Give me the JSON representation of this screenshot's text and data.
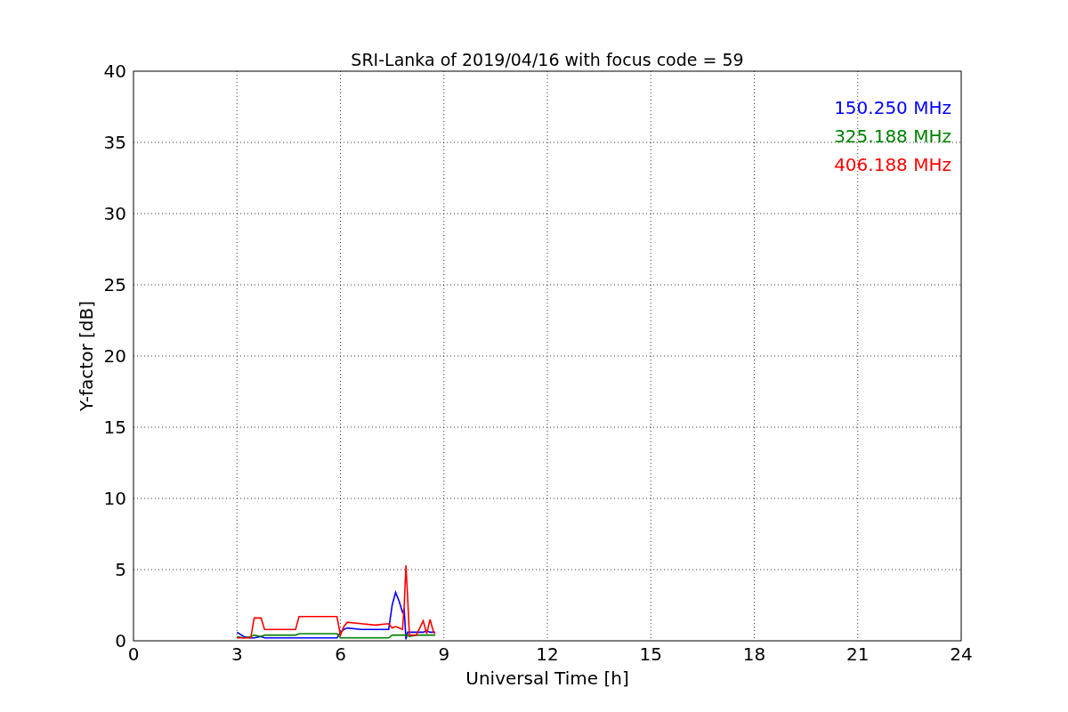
{
  "chart_data": {
    "type": "line",
    "grid": true,
    "title": "SRI-Lanka of 2019/04/16 with focus code = 59",
    "xlabel": "Universal Time [h]",
    "ylabel": "Y-factor [dB]",
    "xlim": [
      0,
      24
    ],
    "ylim": [
      0,
      40
    ],
    "xticks": [
      0,
      3,
      6,
      9,
      12,
      15,
      18,
      21,
      24
    ],
    "yticks": [
      0,
      5,
      10,
      15,
      20,
      25,
      30,
      35,
      40
    ],
    "x": [
      3.0,
      3.2,
      3.4,
      3.5,
      3.7,
      3.8,
      4.2,
      4.7,
      4.8,
      5.4,
      5.9,
      6.0,
      6.1,
      6.2,
      6.6,
      7.0,
      7.4,
      7.5,
      7.6,
      7.7,
      7.8,
      7.85,
      7.9,
      7.95,
      8.0,
      8.2,
      8.4,
      8.5,
      8.6,
      8.7,
      8.75
    ],
    "series": [
      {
        "name": "150.250 MHz",
        "color": "#0000ff",
        "values": [
          0.6,
          0.3,
          0.2,
          0.2,
          0.3,
          0.2,
          0.2,
          0.2,
          0.2,
          0.2,
          0.2,
          0.6,
          0.8,
          0.9,
          0.8,
          0.8,
          0.8,
          2.5,
          3.4,
          2.8,
          2.0,
          2.2,
          0.1,
          0.6,
          0.6,
          0.6,
          0.6,
          0.7,
          0.6,
          0.6,
          0.6
        ]
      },
      {
        "name": "325.188 MHz",
        "color": "#008000",
        "values": [
          0.3,
          0.2,
          0.3,
          0.4,
          0.3,
          0.4,
          0.4,
          0.4,
          0.5,
          0.5,
          0.5,
          0.2,
          0.2,
          0.2,
          0.2,
          0.2,
          0.2,
          0.4,
          0.4,
          0.4,
          0.4,
          0.4,
          0.4,
          0.4,
          0.3,
          0.4,
          0.4,
          0.4,
          0.4,
          0.4,
          0.4
        ]
      },
      {
        "name": "406.188 MHz",
        "color": "#ff0000",
        "values": [
          0.2,
          0.2,
          0.2,
          1.6,
          1.6,
          0.8,
          0.8,
          0.8,
          1.7,
          1.7,
          1.7,
          0.4,
          1.0,
          1.3,
          1.2,
          1.1,
          1.2,
          0.9,
          1.0,
          0.9,
          0.8,
          2.5,
          5.3,
          3.0,
          0.4,
          0.4,
          1.4,
          0.5,
          1.5,
          0.6,
          0.5
        ]
      }
    ]
  }
}
